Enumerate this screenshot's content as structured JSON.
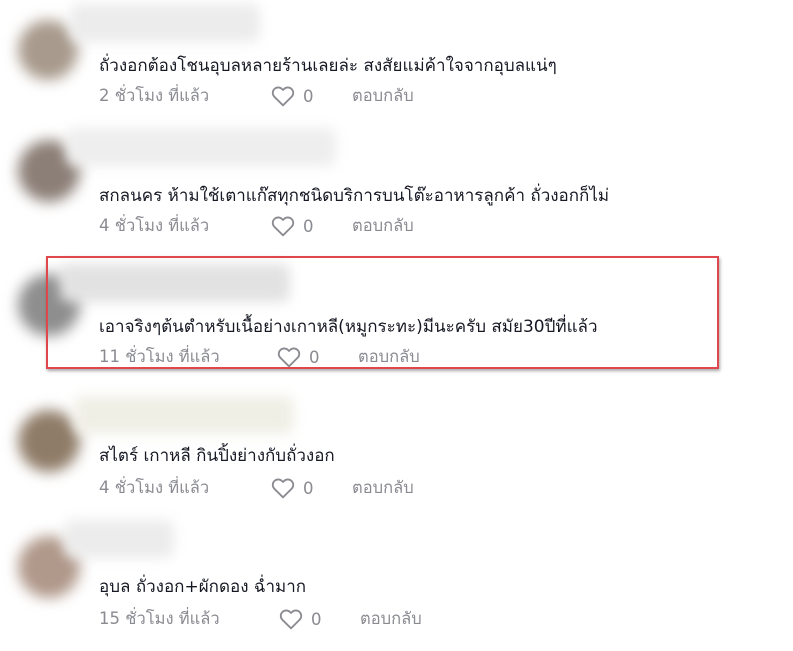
{
  "comments": [
    {
      "text": "ถั่วงอกต้องโชนอุบลหลายร้านเลยล่ะ สงสัยแม่ค้าใจจากอุบลแน่ๆ",
      "time": "2 ชั่วโมง ที่แล้ว",
      "likes": "0",
      "reply": "ตอบกลับ",
      "avatar_color": "#a89a8c"
    },
    {
      "text": "สกลนคร ห้ามใช้เตาแก๊สทุกชนิดบริการบนโต๊ะอาหารลูกค้า ถั่วงอกก็ไม่",
      "time": "4 ชั่วโมง ที่แล้ว",
      "likes": "0",
      "reply": "ตอบกลับ",
      "avatar_color": "#8c7f77"
    },
    {
      "text": "เอาจริงๆต้นตำหรับเนื้อย่างเกาหลี(หมูกระทะ)มีนะครับ สมัย30ปีที่แล้ว",
      "time": "11 ชั่วโมง ที่แล้ว",
      "likes": "0",
      "reply": "ตอบกลับ",
      "avatar_color": "#8e8e8e"
    },
    {
      "text": "สไตร์ เกาหลี กินปิ้งย่างกับถั่วงอก",
      "time": "4 ชั่วโมง ที่แล้ว",
      "likes": "0",
      "reply": "ตอบกลับ",
      "avatar_color": "#8f7c68"
    },
    {
      "text": "อุบล ถั่วงอก+ผักดอง ฉ่ำมาก",
      "time": "15 ชั่วโมง ที่แล้ว",
      "likes": "0",
      "reply": "ตอบกลับ",
      "avatar_color": "#b0988a"
    }
  ],
  "colors": {
    "text": "#161823",
    "meta": "#8a8b91",
    "highlight": "#e0474c"
  },
  "icons": {
    "like": "heart-outline-icon"
  }
}
